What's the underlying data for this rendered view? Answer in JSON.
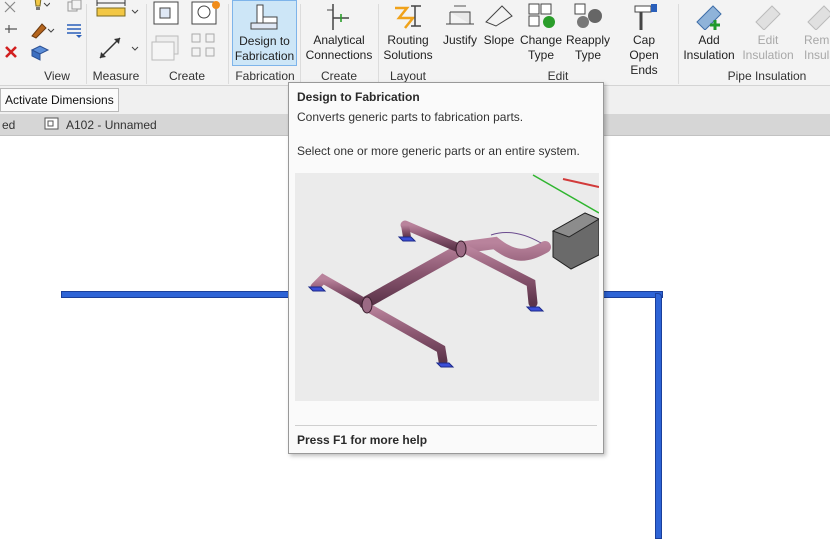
{
  "ribbon": {
    "panels": [
      {
        "label": "View"
      },
      {
        "label": "Measure"
      },
      {
        "label": "Create"
      },
      {
        "label": "Fabrication"
      },
      {
        "label": "Create"
      },
      {
        "label": "Layout"
      },
      {
        "label": "Edit"
      },
      {
        "label": "Pipe Insulation"
      }
    ],
    "tools": {
      "design_to_fabrication": {
        "line1": "Design to",
        "line2": "Fabrication",
        "icon": "design-to-fabrication-icon"
      },
      "analytical_connections": {
        "line1": "Analytical",
        "line2": "Connections",
        "icon": "analytical-connections-icon"
      },
      "routing_solutions": {
        "line1": "Routing",
        "line2": "Solutions",
        "icon": "routing-solutions-icon"
      },
      "justify": {
        "line1": "Justify",
        "icon": "justify-icon"
      },
      "slope": {
        "line1": "Slope",
        "icon": "slope-icon"
      },
      "change_type": {
        "line1": "Change",
        "line2": "Type",
        "icon": "change-type-icon"
      },
      "reapply_type": {
        "line1": "Reapply",
        "line2": "Type",
        "icon": "reapply-type-icon"
      },
      "cap_open_ends": {
        "line1": "Cap",
        "line2": "Open Ends",
        "icon": "cap-open-ends-icon"
      },
      "add_insulation": {
        "line1": "Add",
        "line2": "Insulation",
        "icon": "add-insulation-icon"
      },
      "edit_insulation": {
        "line1": "Edit",
        "line2": "Insulation",
        "icon": "edit-insulation-icon"
      },
      "remove_insulation": {
        "line1": "Rem",
        "line2": "Insula",
        "icon": "remove-insulation-icon"
      }
    }
  },
  "contextual": {
    "activate_dimensions": "Activate Dimensions"
  },
  "view_tabs": {
    "partial_left": "ed",
    "tab_label": "A102 - Unnamed"
  },
  "tooltip": {
    "title": "Design to Fabrication",
    "description": "Converts generic parts to fabrication parts.",
    "instruction": "Select one or more generic parts or an entire system.",
    "help": "Press F1 for more help"
  },
  "colors": {
    "pipe": "#2e64d6",
    "accent": "#7eb4ea",
    "ribbon_bg": "#f3f3f3"
  }
}
